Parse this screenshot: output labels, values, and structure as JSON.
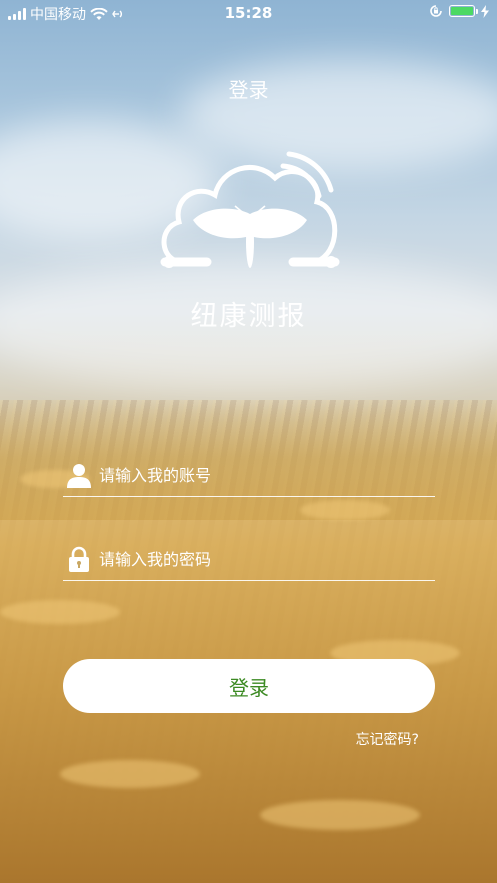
{
  "status_bar": {
    "carrier": "中国移动",
    "time": "15:28"
  },
  "nav": {
    "title": "登录"
  },
  "app": {
    "name": "纽康测报"
  },
  "form": {
    "account_placeholder": "请输入我的账号",
    "password_placeholder": "请输入我的密码",
    "account_value": "",
    "password_value": "",
    "submit_label": "登录",
    "forgot_label": "忘记密码?"
  },
  "colors": {
    "button_text": "#3c8a23",
    "battery": "#4cd964"
  },
  "icons": {
    "account": "user-icon",
    "password": "lock-icon",
    "logo": "cloud-moth-logo"
  }
}
